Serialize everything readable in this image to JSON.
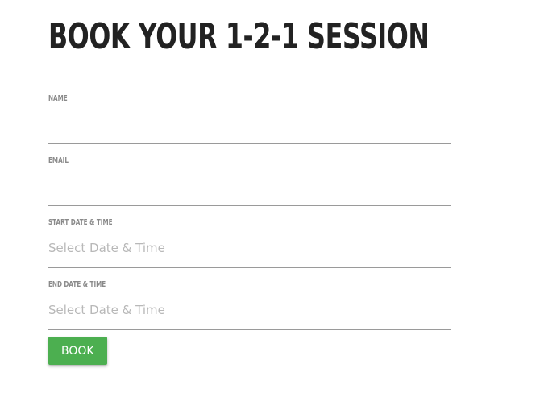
{
  "header": {
    "title": "BOOK YOUR 1-2-1 SESSION"
  },
  "form": {
    "fields": [
      {
        "label": "NAME",
        "value": "",
        "placeholder": ""
      },
      {
        "label": "EMAIL",
        "value": "",
        "placeholder": ""
      },
      {
        "label": "START DATE & TIME",
        "value": "",
        "placeholder": "Select Date & Time"
      },
      {
        "label": "END DATE & TIME",
        "value": "",
        "placeholder": "Select Date & Time"
      }
    ],
    "submit_label": "BOOK"
  },
  "colors": {
    "accent": "#4caf50",
    "title": "#222222",
    "label": "#8a8a8a",
    "placeholder": "#b8b8b8",
    "underline": "#9a9a9a"
  }
}
